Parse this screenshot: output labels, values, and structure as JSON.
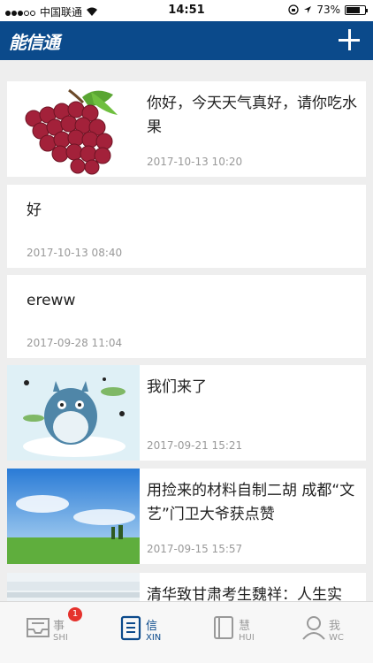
{
  "status_bar": {
    "carrier": "中国联通",
    "time": "14:51",
    "battery": "73%",
    "battery_level": 0.73
  },
  "header": {
    "logo": "能信通",
    "add_icon": "plus-icon"
  },
  "feed": [
    {
      "title": "你好，今天天气真好，请你吃水果",
      "date": "2017-10-13 10:20",
      "image": "grapes"
    },
    {
      "title": "好",
      "date": "2017-10-13 08:40",
      "image": null
    },
    {
      "title": "ereww",
      "date": "2017-09-28 11:04",
      "image": null
    },
    {
      "title": "我们来了",
      "date": "2017-09-21 15:21",
      "image": "totoro"
    },
    {
      "title": "用捡来的材料自制二胡 成都“文艺”门卫大爷获点赞",
      "date": "2017-09-15 15:57",
      "image": "sky"
    },
    {
      "title": "清华致甘肃考生魏祥：人生实",
      "date": "",
      "image": "snow"
    }
  ],
  "tabs": [
    {
      "label": "事",
      "sub": "SHI",
      "badge": "1",
      "icon": "inbox-icon",
      "active": false
    },
    {
      "label": "信",
      "sub": "XIN",
      "badge": "",
      "icon": "document-icon",
      "active": true
    },
    {
      "label": "慧",
      "sub": "HUI",
      "badge": "",
      "icon": "book-icon",
      "active": false
    },
    {
      "label": "我",
      "sub": "WC",
      "badge": "",
      "icon": "user-icon",
      "active": false
    }
  ]
}
